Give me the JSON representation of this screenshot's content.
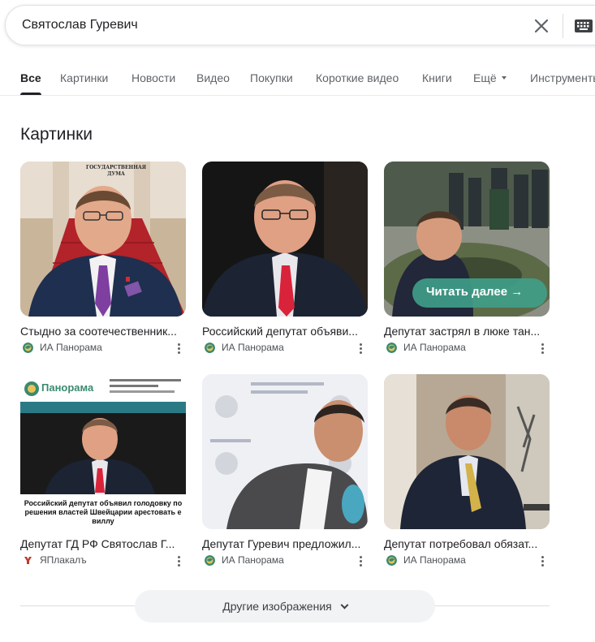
{
  "search": {
    "query": "Святослав Гуревич",
    "clear_icon": "close-icon",
    "keyboard_icon": "keyboard-icon"
  },
  "tabs": [
    {
      "label": "Все",
      "active": true
    },
    {
      "label": "Картинки"
    },
    {
      "label": "Новости"
    },
    {
      "label": "Видео"
    },
    {
      "label": "Покупки"
    },
    {
      "label": "Короткие видео"
    },
    {
      "label": "Книги"
    },
    {
      "label": "Ещё"
    },
    {
      "label": "Инструменты"
    }
  ],
  "images_section": {
    "title": "Картинки",
    "results": [
      {
        "caption": "Стыдно за соотечественник...",
        "source": "ИА Панорама",
        "overlay_lines": [
          "ГОСУДАРСТВЕННАЯ",
          "ДУМА"
        ]
      },
      {
        "caption": "Российский депутат объяви...",
        "source": "ИА Панорама"
      },
      {
        "caption": "Депутат застрял в люке тан...",
        "source": "ИА Панорама",
        "overlay_button": "Читать далее →"
      },
      {
        "caption": "Депутат ГД РФ Святослав Г...",
        "source": "ЯПлакалъ",
        "overlay_brand": "Панорама",
        "overlay_headline": "Российский депутат объявил голодовку по решения властей Швейцарии арестовать е виллу"
      },
      {
        "caption": "Депутат Гуревич предложил...",
        "source": "ИА Панорама"
      },
      {
        "caption": "Депутат потребовал обязат...",
        "source": "ИА Панорама"
      }
    ],
    "more_button": "Другие изображения"
  },
  "colors": {
    "panorama_icon": "#3a8a6e",
    "yaplakal_icon": "#c0392b",
    "accent": "#202124"
  }
}
